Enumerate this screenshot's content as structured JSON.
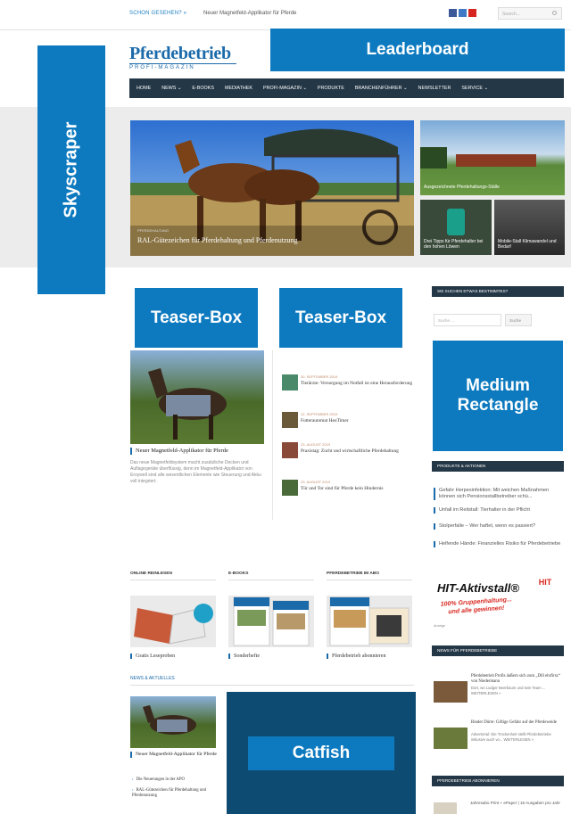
{
  "topbar": {
    "schon_gesehen": "SCHON GESEHEN? »",
    "ticker": "Neuer Magnetfeld-Applikator für Pferde",
    "search_placeholder": "Search..."
  },
  "logo": {
    "title": "Pferdebetrieb",
    "subtitle": "PROFI-MAGAZIN"
  },
  "ads": {
    "leaderboard": "Leaderboard",
    "skyscraper": "Skyscraper",
    "teaser_1": "Teaser-Box",
    "teaser_2": "Teaser-Box",
    "medium_rect_line1": "Medium",
    "medium_rect_line2": "Rectangle",
    "catfish": "Catfish"
  },
  "nav": {
    "items": [
      "HOME",
      "NEWS ⌄",
      "E-BOOKS",
      "MEDIATHEK",
      "PROFI-MAGAZIN ⌄",
      "PRODUKTE",
      "BRANCHENFÜHRER ⌄",
      "NEWSLETTER",
      "SERVICE ⌄"
    ]
  },
  "hero": {
    "main_caption": "RAL-Gütezeichen für Pferdehaltung und Pferdenutzung",
    "main_small": "PFERDEHALTUNG",
    "side_top_caption": "Ausgezeichnete Pferdehaltungs-Ställe",
    "side_bl_caption": "Drei Tipps für Pferdehalter bei den hohen Löwen",
    "side_br_caption": "Mobile-Stall Klimawandel und Bedarf"
  },
  "feature": {
    "title": "Neuer Magnetfeld-Applikator für Pferde",
    "text": "Das neue Magnetfeldsystem macht zusätzliche Decken und Auflagegeräte überflüssig, denn im Magnetfeld-Applikator von Eroywell sind alle wesentlichen Elemente wie Steuerung und Akku voll integriert."
  },
  "news_list": [
    {
      "date": "30. SEPTEMBER 2019",
      "title": "Tierärzte: Versorgung im Notfall ist eine Herausforderung"
    },
    {
      "date": "12. SEPTEMBER 2019",
      "title": "Futterautomat HeuTimer"
    },
    {
      "date": "23. AUGUST 2019",
      "title": "Praxistag: Zucht und wirtschaftliche Pferdehaltung"
    },
    {
      "date": "23. AUGUST 2019",
      "title": "Tür und Tor sind für Pferde kein Hindernis"
    }
  ],
  "sidebar": {
    "search_head": "SIE SUCHEN ETWAS BESTIMMTES?",
    "search_placeholder": "Suche ...",
    "search_button": "Suche",
    "products_head": "PRODUKTE & AKTIONEN",
    "product_links": [
      "Gefahr Herpesinfektion: Mit weichen Maßnahmen können sich Pensionsstallbetreiber schü...",
      "Unfall im Reitstall: Tierhalter in der Pflicht",
      "Stolperfalle – Wer haftet, wenn es passiert?",
      "Helfende Hände: Finanzielles Risiko für Pferdebetriebe"
    ],
    "hit_title": "HIT-Aktivstall",
    "hit_slogan_1": "100% Gruppenhaltung...",
    "hit_slogan_2": "und alle gewinnen!",
    "hit_logo": "HIT",
    "anzeige": "Anzeige",
    "news_head": "NEWS FÜR PFERDEBETRIEBE",
    "news": [
      {
        "title": "Pferdebetrieb Profis äußern sich zum „Dill ehrfirsz“ von Niedermann",
        "desc": "Dort, wo Ludger Beerbaum und sein Team ... WEITERLESEN »"
      },
      {
        "title": "Rinder Dürre: Giftige Gefahr auf der Pferdeweide",
        "desc": "Advertorial: Die Trockenheit stellt Pferdebetriebe inklusive auch vo... WEITERLESEN »"
      }
    ],
    "abo_head": "PFERDEBETRIEB ABONNIEREN",
    "abo_text": "Jahresabo Print + ePaper | 16 Ausgaben pro Jahr"
  },
  "cards": [
    {
      "head": "ONLINE REINLESEN",
      "caption": "Gratis Leseproben"
    },
    {
      "head": "E-BOOKS",
      "caption": "Sonderhefte"
    },
    {
      "head": "PFERDEBETRIEB IM ABO",
      "caption": "Pferdebetrieb abonnieren"
    }
  ],
  "news_aktuelles": {
    "head": "NEWS & AKTUELLES",
    "title": "Neuer Magnetfeld-Applikator für Pferde",
    "links": [
      "Die Neuerungen in der APO",
      "RAL-Gütezeichen für Pferdehaltung und Pferdenutzung"
    ]
  },
  "colors": {
    "brand": "#1b6aaa",
    "ad_blue": "#0d7abf",
    "nav_dark": "#243746",
    "catfish_dark": "#0e4b73"
  }
}
